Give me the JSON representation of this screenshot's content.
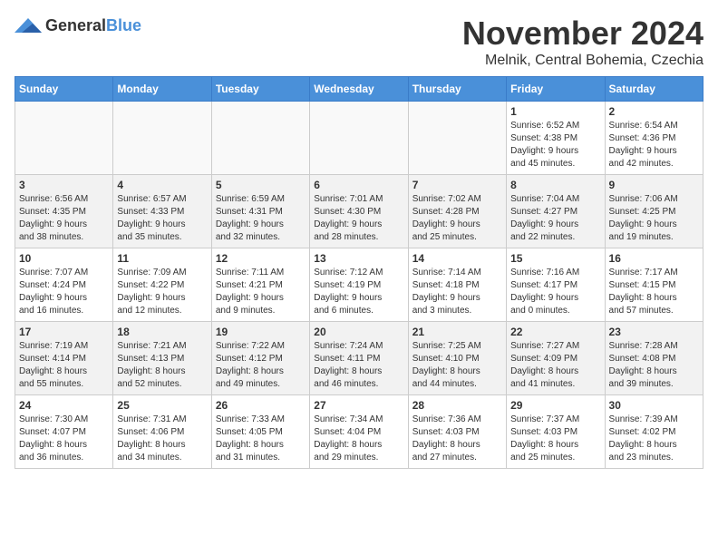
{
  "logo": {
    "text_general": "General",
    "text_blue": "Blue"
  },
  "header": {
    "month": "November 2024",
    "location": "Melnik, Central Bohemia, Czechia"
  },
  "weekdays": [
    "Sunday",
    "Monday",
    "Tuesday",
    "Wednesday",
    "Thursday",
    "Friday",
    "Saturday"
  ],
  "weeks": [
    {
      "shaded": false,
      "days": [
        {
          "num": "",
          "info": ""
        },
        {
          "num": "",
          "info": ""
        },
        {
          "num": "",
          "info": ""
        },
        {
          "num": "",
          "info": ""
        },
        {
          "num": "",
          "info": ""
        },
        {
          "num": "1",
          "info": "Sunrise: 6:52 AM\nSunset: 4:38 PM\nDaylight: 9 hours\nand 45 minutes."
        },
        {
          "num": "2",
          "info": "Sunrise: 6:54 AM\nSunset: 4:36 PM\nDaylight: 9 hours\nand 42 minutes."
        }
      ]
    },
    {
      "shaded": true,
      "days": [
        {
          "num": "3",
          "info": "Sunrise: 6:56 AM\nSunset: 4:35 PM\nDaylight: 9 hours\nand 38 minutes."
        },
        {
          "num": "4",
          "info": "Sunrise: 6:57 AM\nSunset: 4:33 PM\nDaylight: 9 hours\nand 35 minutes."
        },
        {
          "num": "5",
          "info": "Sunrise: 6:59 AM\nSunset: 4:31 PM\nDaylight: 9 hours\nand 32 minutes."
        },
        {
          "num": "6",
          "info": "Sunrise: 7:01 AM\nSunset: 4:30 PM\nDaylight: 9 hours\nand 28 minutes."
        },
        {
          "num": "7",
          "info": "Sunrise: 7:02 AM\nSunset: 4:28 PM\nDaylight: 9 hours\nand 25 minutes."
        },
        {
          "num": "8",
          "info": "Sunrise: 7:04 AM\nSunset: 4:27 PM\nDaylight: 9 hours\nand 22 minutes."
        },
        {
          "num": "9",
          "info": "Sunrise: 7:06 AM\nSunset: 4:25 PM\nDaylight: 9 hours\nand 19 minutes."
        }
      ]
    },
    {
      "shaded": false,
      "days": [
        {
          "num": "10",
          "info": "Sunrise: 7:07 AM\nSunset: 4:24 PM\nDaylight: 9 hours\nand 16 minutes."
        },
        {
          "num": "11",
          "info": "Sunrise: 7:09 AM\nSunset: 4:22 PM\nDaylight: 9 hours\nand 12 minutes."
        },
        {
          "num": "12",
          "info": "Sunrise: 7:11 AM\nSunset: 4:21 PM\nDaylight: 9 hours\nand 9 minutes."
        },
        {
          "num": "13",
          "info": "Sunrise: 7:12 AM\nSunset: 4:19 PM\nDaylight: 9 hours\nand 6 minutes."
        },
        {
          "num": "14",
          "info": "Sunrise: 7:14 AM\nSunset: 4:18 PM\nDaylight: 9 hours\nand 3 minutes."
        },
        {
          "num": "15",
          "info": "Sunrise: 7:16 AM\nSunset: 4:17 PM\nDaylight: 9 hours\nand 0 minutes."
        },
        {
          "num": "16",
          "info": "Sunrise: 7:17 AM\nSunset: 4:15 PM\nDaylight: 8 hours\nand 57 minutes."
        }
      ]
    },
    {
      "shaded": true,
      "days": [
        {
          "num": "17",
          "info": "Sunrise: 7:19 AM\nSunset: 4:14 PM\nDaylight: 8 hours\nand 55 minutes."
        },
        {
          "num": "18",
          "info": "Sunrise: 7:21 AM\nSunset: 4:13 PM\nDaylight: 8 hours\nand 52 minutes."
        },
        {
          "num": "19",
          "info": "Sunrise: 7:22 AM\nSunset: 4:12 PM\nDaylight: 8 hours\nand 49 minutes."
        },
        {
          "num": "20",
          "info": "Sunrise: 7:24 AM\nSunset: 4:11 PM\nDaylight: 8 hours\nand 46 minutes."
        },
        {
          "num": "21",
          "info": "Sunrise: 7:25 AM\nSunset: 4:10 PM\nDaylight: 8 hours\nand 44 minutes."
        },
        {
          "num": "22",
          "info": "Sunrise: 7:27 AM\nSunset: 4:09 PM\nDaylight: 8 hours\nand 41 minutes."
        },
        {
          "num": "23",
          "info": "Sunrise: 7:28 AM\nSunset: 4:08 PM\nDaylight: 8 hours\nand 39 minutes."
        }
      ]
    },
    {
      "shaded": false,
      "days": [
        {
          "num": "24",
          "info": "Sunrise: 7:30 AM\nSunset: 4:07 PM\nDaylight: 8 hours\nand 36 minutes."
        },
        {
          "num": "25",
          "info": "Sunrise: 7:31 AM\nSunset: 4:06 PM\nDaylight: 8 hours\nand 34 minutes."
        },
        {
          "num": "26",
          "info": "Sunrise: 7:33 AM\nSunset: 4:05 PM\nDaylight: 8 hours\nand 31 minutes."
        },
        {
          "num": "27",
          "info": "Sunrise: 7:34 AM\nSunset: 4:04 PM\nDaylight: 8 hours\nand 29 minutes."
        },
        {
          "num": "28",
          "info": "Sunrise: 7:36 AM\nSunset: 4:03 PM\nDaylight: 8 hours\nand 27 minutes."
        },
        {
          "num": "29",
          "info": "Sunrise: 7:37 AM\nSunset: 4:03 PM\nDaylight: 8 hours\nand 25 minutes."
        },
        {
          "num": "30",
          "info": "Sunrise: 7:39 AM\nSunset: 4:02 PM\nDaylight: 8 hours\nand 23 minutes."
        }
      ]
    }
  ]
}
